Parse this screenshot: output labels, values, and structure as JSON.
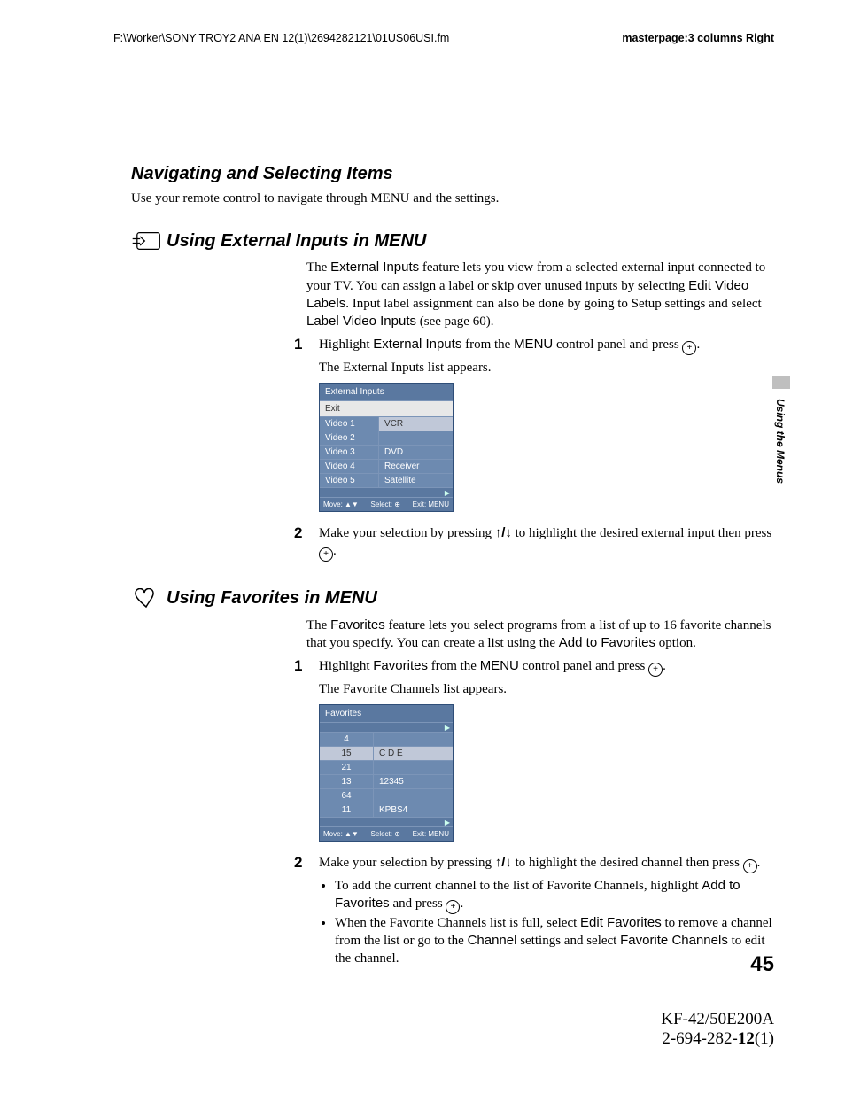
{
  "header": {
    "left": "F:\\Worker\\SONY TROY2 ANA EN 12(1)\\2694282121\\01US06USI.fm",
    "right": "masterpage:3 columns Right"
  },
  "sideTab": "Using the Menus",
  "section1": {
    "title": "Navigating and Selecting Items",
    "intro": "Use your remote control to navigate through MENU and the settings."
  },
  "extInputs": {
    "title": "Using External Inputs in MENU",
    "para1_pre": "The ",
    "para1_bold1": "External Inputs",
    "para1_mid1": " feature lets you view from a selected external input connected to your TV. You can assign a label or skip over unused inputs by selecting ",
    "para1_bold2": "Edit Video Labels",
    "para1_mid2": ". Input label assignment can also be done by going to Setup settings and select ",
    "para1_bold3": "Label Video Inputs",
    "para1_end": " (see page 60).",
    "step1_num": "1",
    "step1_a": "Highlight ",
    "step1_b": "External Inputs",
    "step1_c": " from the ",
    "step1_d": "MENU",
    "step1_e": " control panel and press ",
    "step1_f": ".",
    "step1_line2": "The External Inputs list appears.",
    "panel": {
      "title": "External Inputs",
      "exit": "Exit",
      "rows": [
        {
          "l": "Video  1",
          "r": "VCR",
          "hl": true
        },
        {
          "l": "Video  2",
          "r": ""
        },
        {
          "l": "Video  3",
          "r": "DVD"
        },
        {
          "l": "Video  4",
          "r": "Receiver"
        },
        {
          "l": "Video  5",
          "r": "Satellite"
        }
      ],
      "footer": {
        "move": "Move: ▲▼",
        "select": "Select: ⊕",
        "exit": "Exit: MENU"
      }
    },
    "step2_num": "2",
    "step2_a": "Make your selection by pressing ",
    "step2_arrows": "↑/↓",
    "step2_b": " to highlight the desired external input then press ",
    "step2_c": "."
  },
  "favorites": {
    "title": "Using Favorites in MENU",
    "para1_pre": "The ",
    "para1_b1": "Favorites",
    "para1_mid": " feature lets you select programs from a list of up to 16 favorite channels that you specify. You can create a list using the ",
    "para1_b2": "Add to Favorites",
    "para1_end": " option.",
    "step1_num": "1",
    "step1_a": "Highlight ",
    "step1_b": "Favorites",
    "step1_c": " from the ",
    "step1_d": "MENU",
    "step1_e": " control panel and press ",
    "step1_f": ".",
    "step1_line2": "The Favorite Channels list appears.",
    "panel": {
      "title": "Favorites",
      "rows": [
        {
          "c": "4",
          "r": ""
        },
        {
          "c": "15",
          "r": "C D E",
          "hl": true
        },
        {
          "c": "21",
          "r": ""
        },
        {
          "c": "13",
          "r": "12345"
        },
        {
          "c": "64",
          "r": ""
        },
        {
          "c": "11",
          "r": "KPBS4"
        }
      ],
      "footer": {
        "move": "Move: ▲▼",
        "select": "Select: ⊕",
        "exit": "Exit: MENU"
      }
    },
    "step2_num": "2",
    "step2_a": "Make your selection by pressing ",
    "step2_arrows": "↑/↓",
    "step2_b": " to highlight the desired channel then press ",
    "step2_c": ".",
    "bullet1_a": "To add the current channel to the list of Favorite Channels, highlight ",
    "bullet1_b": "Add to Favorites",
    "bullet1_c": " and press ",
    "bullet1_d": ".",
    "bullet2_a": "When the Favorite Channels list is full, select ",
    "bullet2_b": "Edit Favorites",
    "bullet2_c": " to remove a channel from the list or go to the ",
    "bullet2_d": "Channel",
    "bullet2_e": " settings and select ",
    "bullet2_f": "Favorite Channels",
    "bullet2_g": " to edit the channel."
  },
  "pageNum": "45",
  "footer": {
    "line1": "KF-42/50E200A",
    "line2_a": "2-694-282-",
    "line2_b": "12",
    "line2_c": "(1)"
  }
}
